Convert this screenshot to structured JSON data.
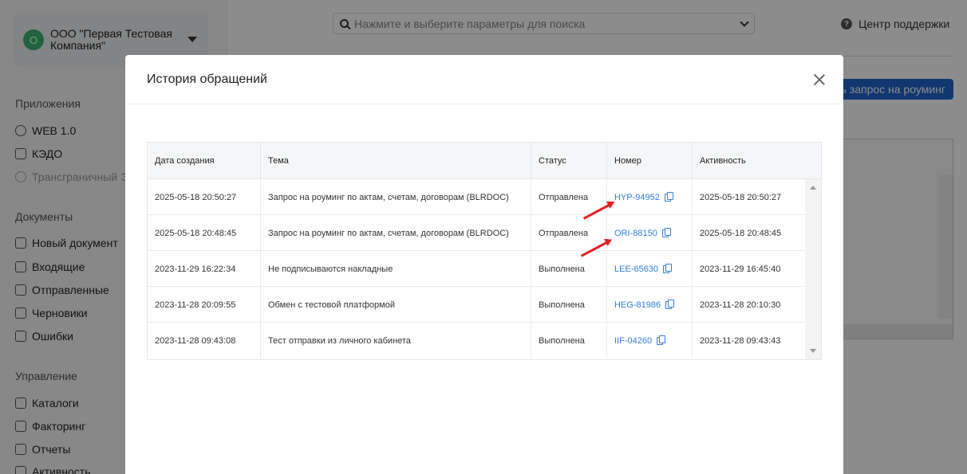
{
  "sidebar": {
    "org": {
      "avatar": "О",
      "name": "ООО \"Первая Тестовая Компания\""
    },
    "sections": {
      "apps": {
        "title": "Приложения",
        "items": [
          "WEB 1.0",
          "КЭДО",
          "Трансграничный Э"
        ]
      },
      "docs": {
        "title": "Документы",
        "items": [
          "Новый документ",
          "Входящие",
          "Отправленные",
          "Черновики",
          "Ошибки"
        ]
      },
      "mgmt": {
        "title": "Управление",
        "items": [
          "Каталоги",
          "Факторинг",
          "Отчеты",
          "Активность"
        ]
      }
    }
  },
  "header": {
    "search_placeholder": "Нажмите и выберите параметры для поиска",
    "support": "Центр поддержки",
    "roaming_button": "ть запрос на роуминг"
  },
  "modal": {
    "title": "История обращений",
    "columns": [
      "Дата создания",
      "Тема",
      "Статус",
      "Номер",
      "Активность"
    ],
    "rows": [
      {
        "created": "2025-05-18 20:50:27",
        "topic": "Запрос на роуминг по актам, счетам, договорам (BLRDOC)",
        "status": "Отправлена",
        "number": "HYP-94952",
        "activity": "2025-05-18 20:50:27"
      },
      {
        "created": "2025-05-18 20:48:45",
        "topic": "Запрос на роуминг по актам, счетам, договорам (BLRDOC)",
        "status": "Отправлена",
        "number": "ORI-88150",
        "activity": "2025-05-18 20:48:45"
      },
      {
        "created": "2023-11-29 16:22:34",
        "topic": "Не подписываются накладные",
        "status": "Выполнена",
        "number": "LEE-65630",
        "activity": "2023-11-29 16:45:40"
      },
      {
        "created": "2023-11-28 20:09:55",
        "topic": "Обмен с тестовой платформой",
        "status": "Выполнена",
        "number": "HEG-81986",
        "activity": "2023-11-28 20:10:30"
      },
      {
        "created": "2023-11-28 09:43:08",
        "topic": "Тест отправки из личного кабинета",
        "status": "Выполнена",
        "number": "IIF-04260",
        "activity": "2023-11-28 09:43:43"
      }
    ]
  },
  "colors": {
    "accent": "#1f64c9",
    "link": "#2f80d9",
    "annotation_arrow": "#e02020"
  }
}
